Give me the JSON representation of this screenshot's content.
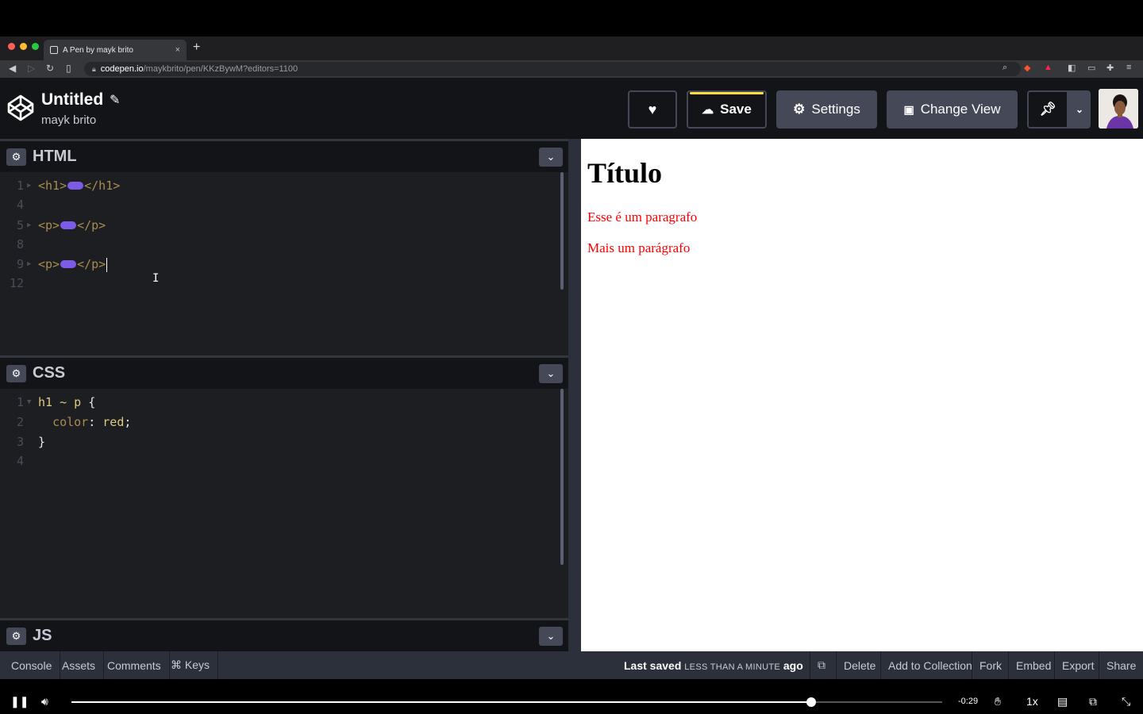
{
  "browser": {
    "tab_title": "A Pen by mayk brito",
    "tab_close": "×",
    "new_tab": "+",
    "url_host": "codepen.io",
    "url_path": "/maykbrito/pen/KKzBywM?editors=1100"
  },
  "header": {
    "pen_title": "Untitled",
    "author": "mayk brito",
    "save_label": "Save",
    "settings_label": "Settings",
    "change_view_label": "Change View"
  },
  "html_editor": {
    "title": "HTML",
    "lines": [
      {
        "num": "1",
        "open": "<h1>",
        "close": "</h1>"
      },
      {
        "num": "4"
      },
      {
        "num": "5",
        "open": "<p>",
        "close": "</p>"
      },
      {
        "num": "8"
      },
      {
        "num": "9",
        "open": "<p>",
        "close": "</p>"
      },
      {
        "num": "12"
      }
    ]
  },
  "css_editor": {
    "title": "CSS",
    "line_numbers": [
      "1",
      "2",
      "3",
      "4"
    ],
    "selector": "h1 ~ p",
    "open_brace": "{",
    "property": "color",
    "value": "red",
    "close_brace": "}"
  },
  "js_editor": {
    "title": "JS"
  },
  "preview": {
    "heading": "Título",
    "paragraph1": "Esse é um paragrafo",
    "paragraph2": "Mais um parágrafo",
    "paragraph_color": "#ff0000"
  },
  "footer": {
    "console": "Console",
    "assets": "Assets",
    "comments": "Comments",
    "keys": "⌘ Keys",
    "last_saved_prefix": "Last saved",
    "last_saved_time": "LESS THAN A MINUTE",
    "last_saved_suffix": "ago",
    "delete": "Delete",
    "add_to_collection": "Add to Collection",
    "fork": "Fork",
    "embed": "Embed",
    "export": "Export",
    "share": "Share"
  },
  "player": {
    "time_remaining": "-0:29",
    "speed": "1x",
    "progress": 0.85
  },
  "colors": {
    "accent_yellow": "#ffdd40",
    "editor_bg": "#1d1e22",
    "header_bg": "#131417",
    "button_bg": "#444857"
  }
}
